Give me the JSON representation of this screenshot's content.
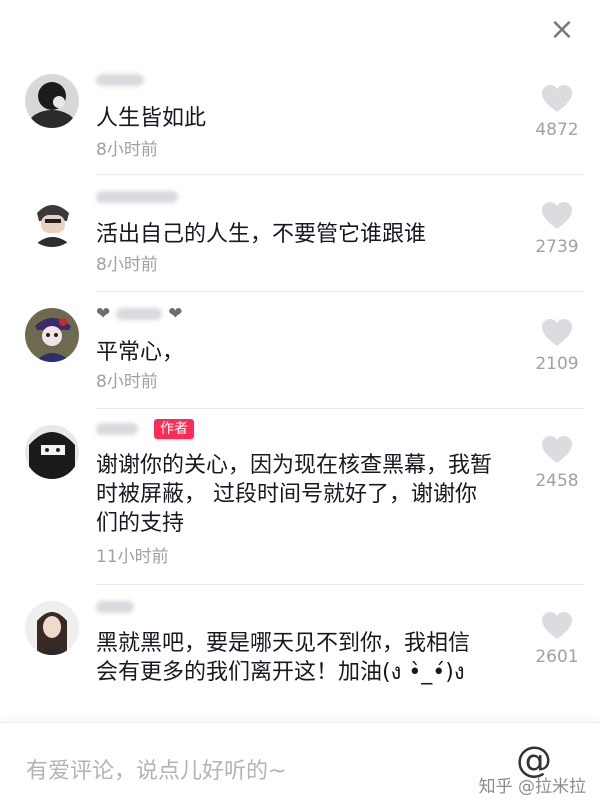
{
  "header": {
    "close_glyph": "×",
    "close_icon": "close-icon"
  },
  "comments": [
    {
      "author_badge": "",
      "text": "人生皆如此",
      "time": "8小时前",
      "likes": "4872"
    },
    {
      "author_badge": "",
      "text": "活出自己的人生，不要管它谁跟谁",
      "time": "8小时前",
      "likes": "2739"
    },
    {
      "author_badge": "",
      "text": "平常心，",
      "time": "8小时前",
      "likes": "2109"
    },
    {
      "author_badge": "作者",
      "text": "谢谢你的关心，因为现在核查黑幕，我暂时被屏蔽， 过段时间号就好了，谢谢你们的支持",
      "time": "11小时前",
      "likes": "2458"
    },
    {
      "author_badge": "",
      "text": "黑就黑吧，要是哪天见不到你，我相信会有更多的我们离开这！加油(ง •̀_•́)ง",
      "time": "",
      "likes": "2601"
    }
  ],
  "input": {
    "placeholder": "有爱评论，说点儿好听的~",
    "at_glyph": "@"
  },
  "watermark": "知乎 @拉米拉",
  "colors": {
    "author_badge": "#fe2c55",
    "like_icon": "#dcdce0",
    "time_text": "#a0a0a7"
  }
}
